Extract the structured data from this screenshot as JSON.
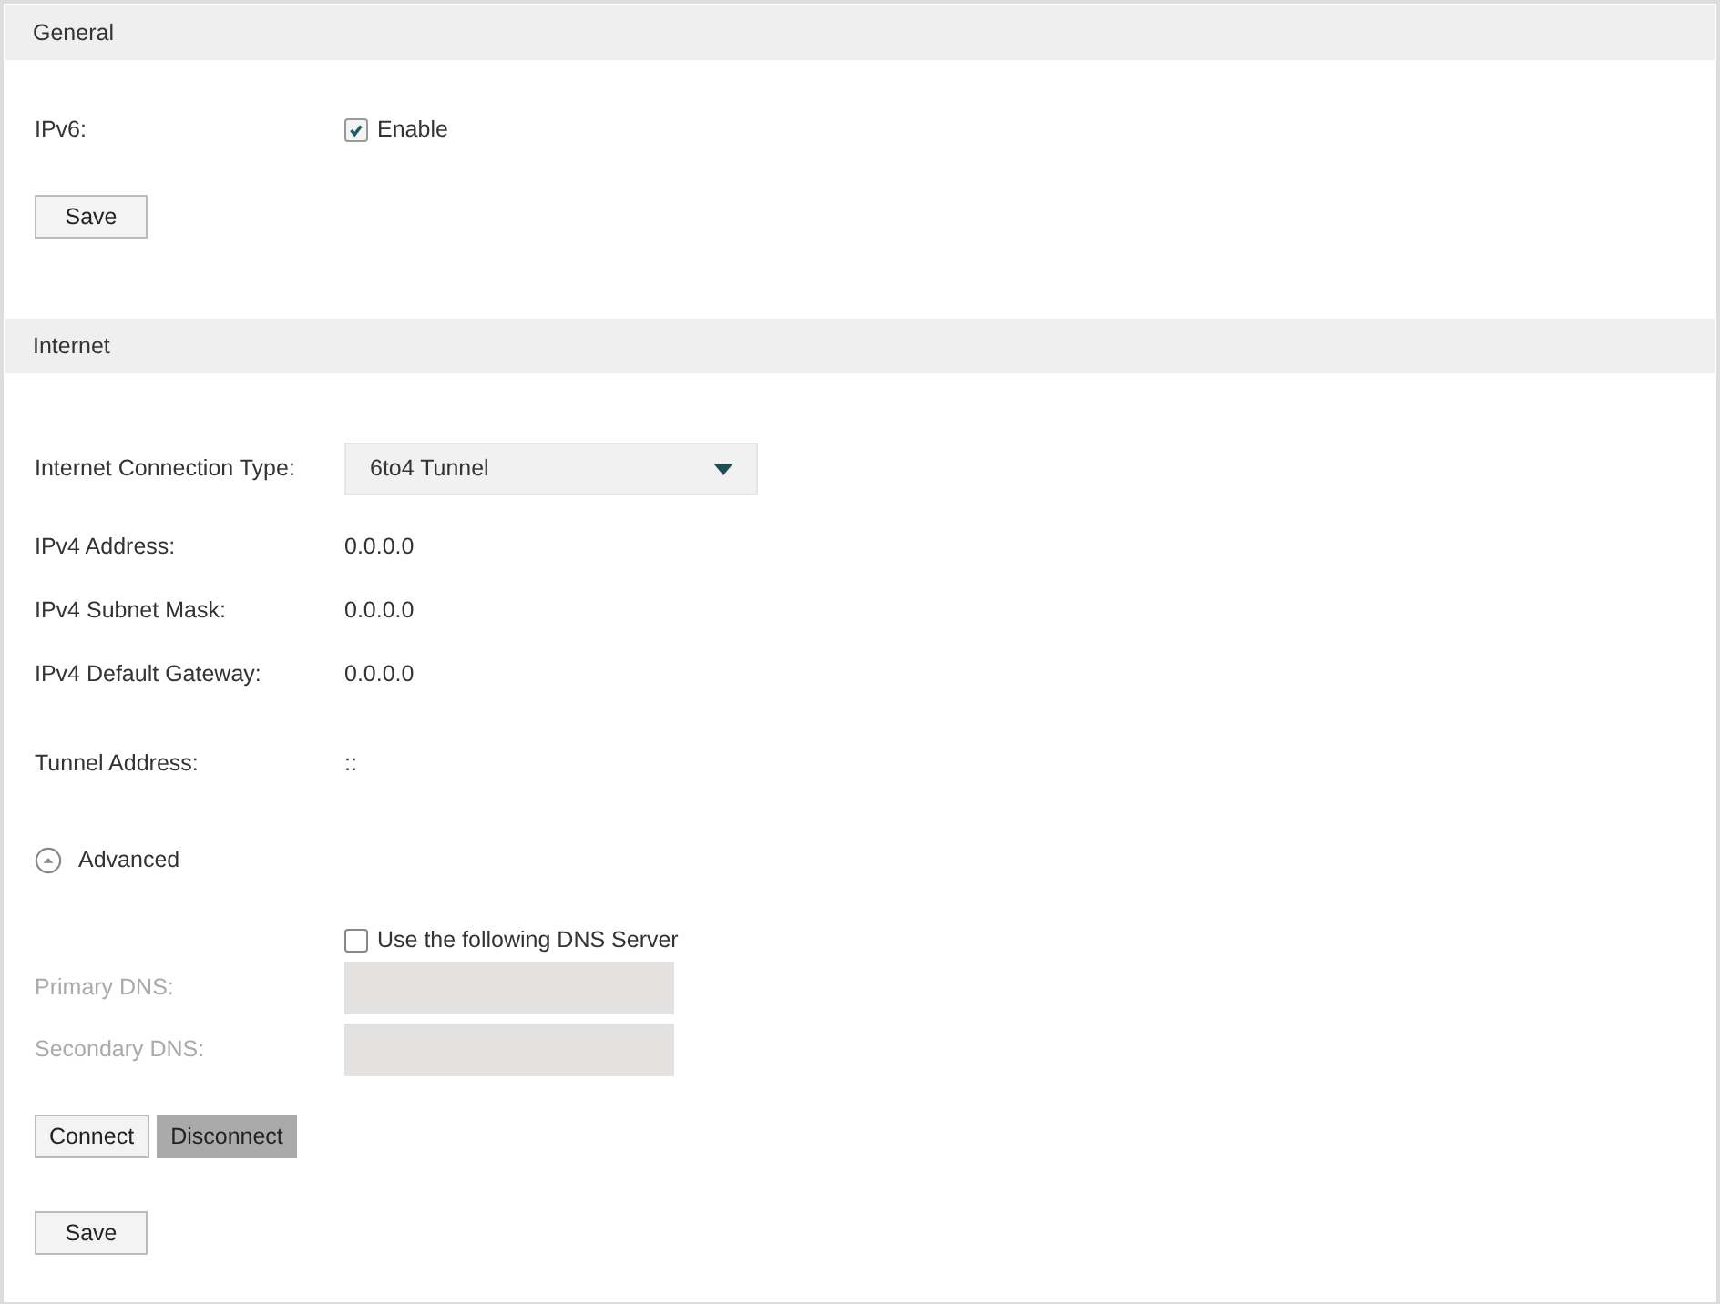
{
  "general": {
    "title": "General",
    "ipv6": {
      "label": "IPv6:",
      "option": "Enable",
      "checked": true
    },
    "save": "Save"
  },
  "internet": {
    "title": "Internet",
    "connection_type": {
      "label": "Internet Connection Type:",
      "value": "6to4 Tunnel"
    },
    "info": [
      {
        "label": "IPv4 Address:",
        "value": "0.0.0.0"
      },
      {
        "label": "IPv4 Subnet Mask:",
        "value": "0.0.0.0"
      },
      {
        "label": "IPv4 Default Gateway:",
        "value": "0.0.0.0"
      }
    ],
    "tunnel": {
      "label": "Tunnel Address:",
      "value": "::"
    },
    "advanced": {
      "label": "Advanced",
      "expanded": true
    },
    "dns_option": {
      "label": "Use the following DNS Server",
      "checked": false
    },
    "dns_fields": [
      {
        "label": "Primary DNS:",
        "disabled": true
      },
      {
        "label": "Secondary DNS:",
        "disabled": true
      }
    ],
    "actions": [
      {
        "label": "Connect",
        "disabled": false
      },
      {
        "label": "Disconnect",
        "disabled": true
      }
    ],
    "save": "Save"
  }
}
